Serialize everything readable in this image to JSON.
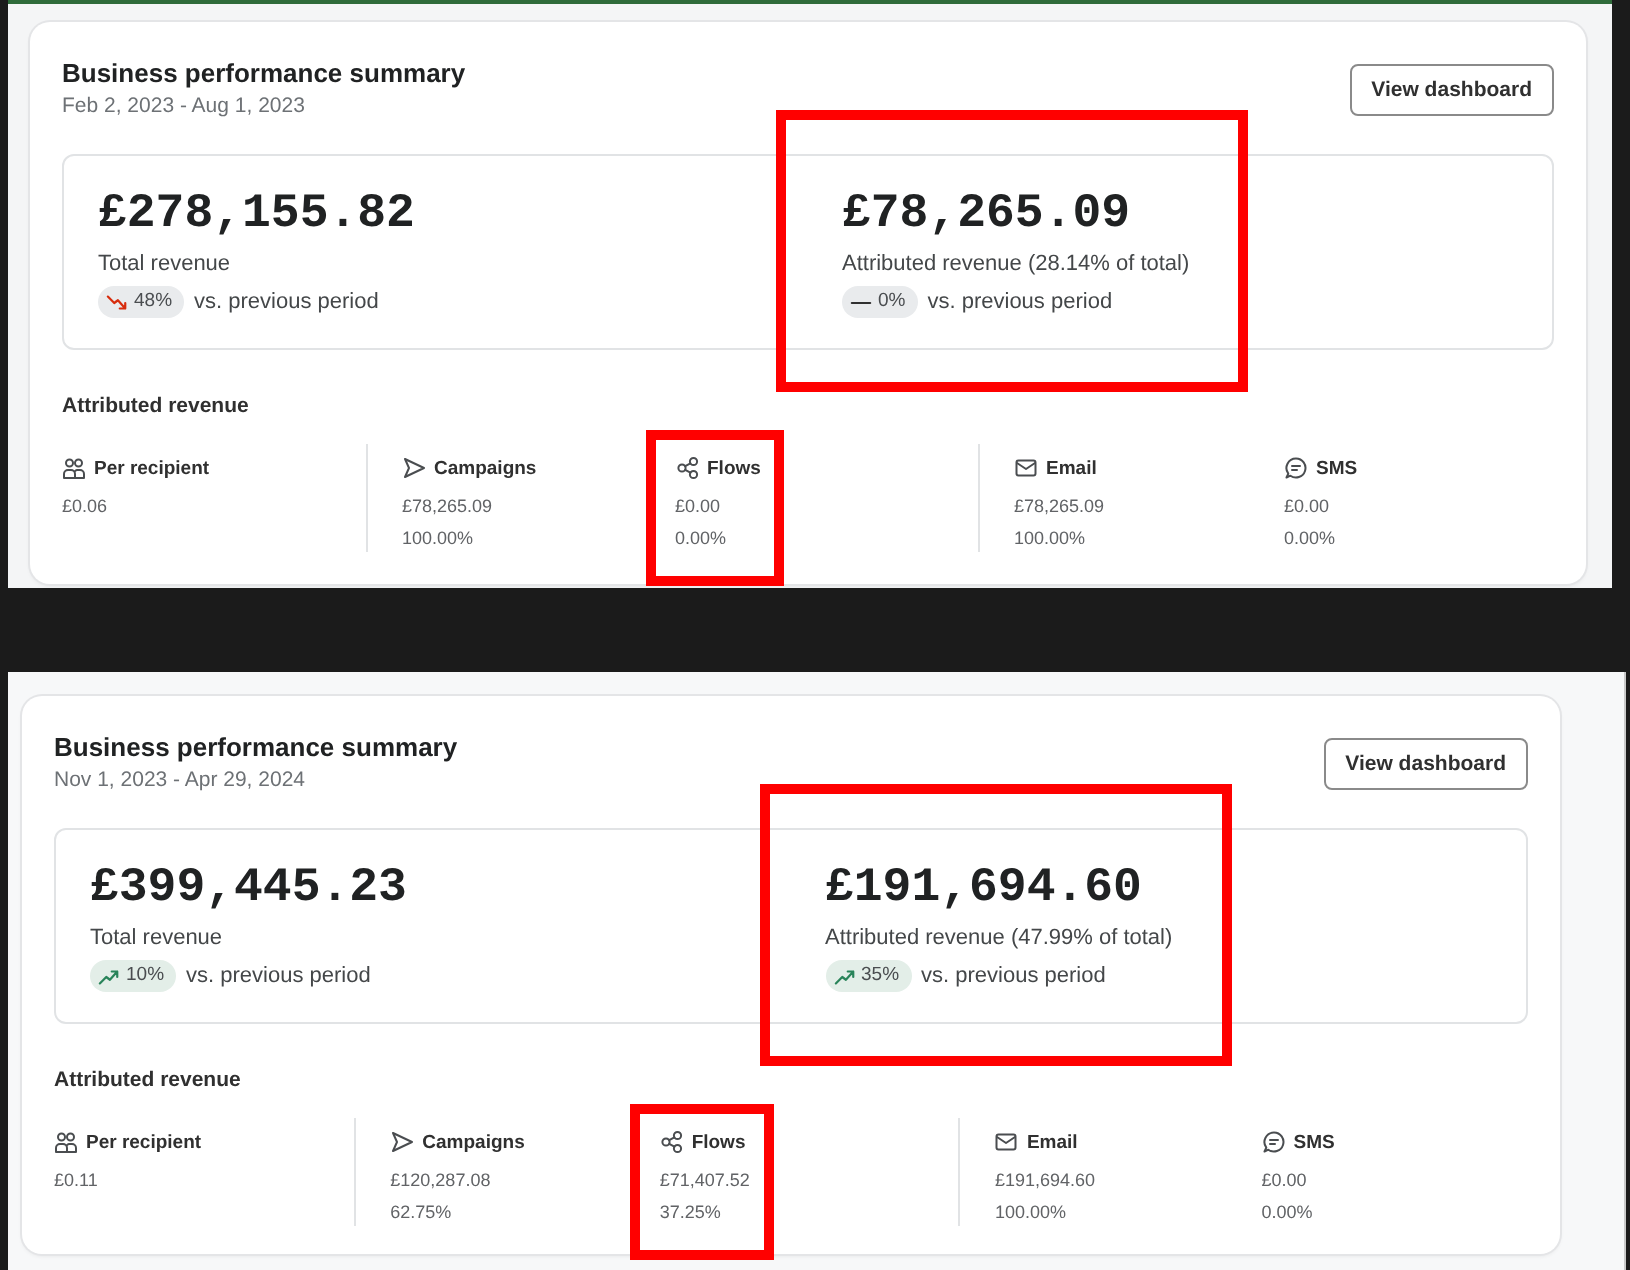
{
  "screenshots": [
    {
      "title": "Business performance summary",
      "date_range": "Feb 2, 2023 - Aug 1, 2023",
      "button": "View dashboard",
      "metrics": [
        {
          "value": "£278,155.82",
          "label": "Total revenue",
          "change": {
            "kind": "down",
            "value": "48%"
          },
          "comparison": "vs. previous period",
          "highlighted": false
        },
        {
          "value": "£78,265.09",
          "label": "Attributed revenue (28.14% of total)",
          "change": {
            "kind": "flat",
            "value": "0%"
          },
          "comparison": "vs. previous period",
          "highlighted": true
        }
      ],
      "breakdown_title": "Attributed revenue",
      "breakdown": [
        [
          {
            "kind": "recipient",
            "label": "Per recipient",
            "value": "£0.06",
            "highlighted": false
          }
        ],
        [
          {
            "kind": "campaigns",
            "label": "Campaigns",
            "value": "£78,265.09",
            "share": "100.00%",
            "highlighted": false
          },
          {
            "kind": "flows",
            "label": "Flows",
            "value": "£0.00",
            "share": "0.00%",
            "highlighted": true
          }
        ],
        [
          {
            "kind": "email",
            "label": "Email",
            "value": "£78,265.09",
            "share": "100.00%",
            "highlighted": false
          },
          {
            "kind": "sms",
            "label": "SMS",
            "value": "£0.00",
            "share": "0.00%",
            "highlighted": false
          }
        ]
      ]
    },
    {
      "title": "Business performance summary",
      "date_range": "Nov 1, 2023 - Apr 29, 2024",
      "button": "View dashboard",
      "metrics": [
        {
          "value": "£399,445.23",
          "label": "Total revenue",
          "change": {
            "kind": "up",
            "value": "10%"
          },
          "comparison": "vs. previous period",
          "highlighted": false
        },
        {
          "value": "£191,694.60",
          "label": "Attributed revenue (47.99% of total)",
          "change": {
            "kind": "up",
            "value": "35%"
          },
          "comparison": "vs. previous period",
          "highlighted": true
        }
      ],
      "breakdown_title": "Attributed revenue",
      "breakdown": [
        [
          {
            "kind": "recipient",
            "label": "Per recipient",
            "value": "£0.11",
            "highlighted": false
          }
        ],
        [
          {
            "kind": "campaigns",
            "label": "Campaigns",
            "value": "£120,287.08",
            "share": "62.75%",
            "highlighted": false
          },
          {
            "kind": "flows",
            "label": "Flows",
            "value": "£71,407.52",
            "share": "37.25%",
            "highlighted": true
          }
        ],
        [
          {
            "kind": "email",
            "label": "Email",
            "value": "£191,694.60",
            "share": "100.00%",
            "highlighted": false
          },
          {
            "kind": "sms",
            "label": "SMS",
            "value": "£0.00",
            "share": "0.00%",
            "highlighted": false
          }
        ]
      ]
    }
  ]
}
